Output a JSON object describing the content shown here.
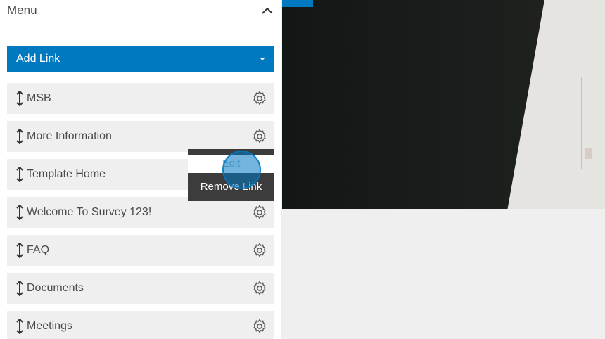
{
  "menu": {
    "title": "Menu",
    "collapse_icon": "chevron-up-icon"
  },
  "add_link": {
    "label": "Add Link",
    "caret_icon": "caret-down-icon"
  },
  "items": [
    {
      "label": "MSB"
    },
    {
      "label": "More Information"
    },
    {
      "label": "Template Home"
    },
    {
      "label": "Welcome To Survey 123!"
    },
    {
      "label": "FAQ"
    },
    {
      "label": "Documents"
    },
    {
      "label": "Meetings"
    }
  ],
  "context_menu": {
    "edit_label": "Edit",
    "remove_label": "Remove Link"
  },
  "colors": {
    "accent": "#0079c1",
    "item_bg": "#efefef",
    "popup_bg": "#3c3c3c"
  }
}
